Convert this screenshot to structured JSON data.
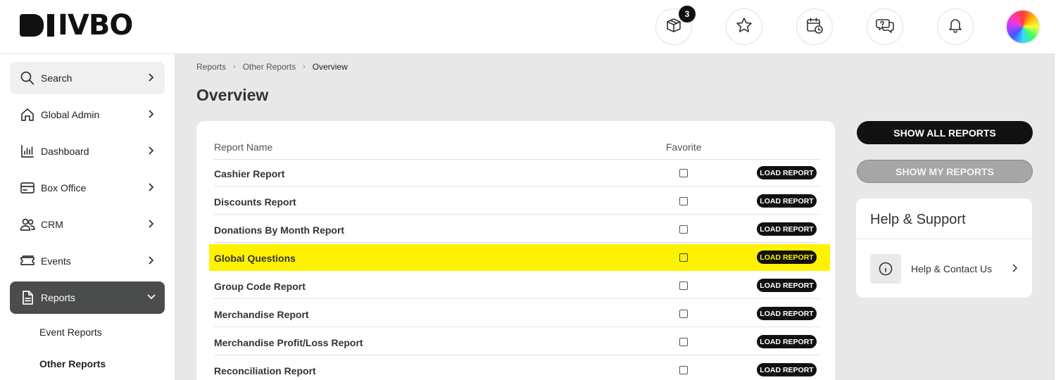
{
  "brand": {
    "logo_text": "IVBO"
  },
  "header": {
    "icons": [
      {
        "name": "box-icon",
        "badge": "3"
      },
      {
        "name": "star-icon"
      },
      {
        "name": "calendar-clock-icon"
      },
      {
        "name": "chat-icon"
      },
      {
        "name": "bell-icon"
      }
    ]
  },
  "sidebar": {
    "search_label": "Search",
    "items": [
      {
        "label": "Global Admin",
        "icon": "home-icon"
      },
      {
        "label": "Dashboard",
        "icon": "bar-chart-icon"
      },
      {
        "label": "Box Office",
        "icon": "card-icon"
      },
      {
        "label": "CRM",
        "icon": "users-icon"
      },
      {
        "label": "Events",
        "icon": "ticket-icon"
      },
      {
        "label": "Reports",
        "icon": "document-icon"
      }
    ],
    "sub_items": [
      "Event Reports",
      "Other Reports"
    ]
  },
  "breadcrumb": [
    "Reports",
    "Other Reports",
    "Overview"
  ],
  "page_title": "Overview",
  "table": {
    "columns": [
      "Report Name",
      "Favorite"
    ],
    "load_label": "LOAD REPORT",
    "rows": [
      "Cashier Report",
      "Discounts Report",
      "Donations By Month Report",
      "Global Questions",
      "Group Code Report",
      "Merchandise Report",
      "Merchandise Profit/Loss Report",
      "Reconciliation Report"
    ],
    "highlighted_row": "Global Questions"
  },
  "buttons": {
    "show_all": "SHOW ALL REPORTS",
    "show_my": "SHOW MY REPORTS"
  },
  "help": {
    "title": "Help & Support",
    "link_label": "Help & Contact Us"
  },
  "colors": {
    "highlight": "#fff200",
    "active_nav": "#4a4d4c",
    "primary_button": "#111111"
  }
}
